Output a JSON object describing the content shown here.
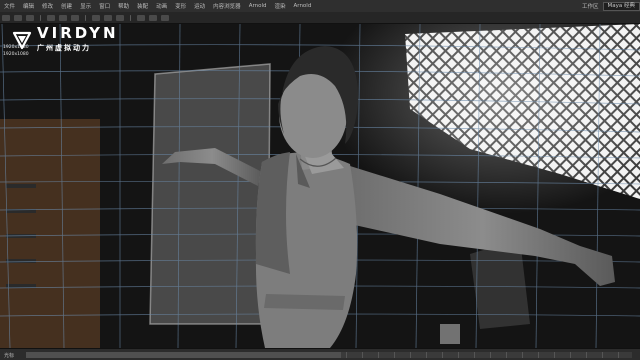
{
  "menubar": {
    "items": [
      "文件",
      "编辑",
      "修改",
      "创建",
      "显示",
      "窗口",
      "帮助",
      "装配",
      "动画",
      "变形",
      "运动",
      "内容浏览器",
      "Arnold",
      "渲染",
      "Arnold"
    ],
    "workspace_label": "工作区",
    "workspace_value": "Maya 经典"
  },
  "viewport": {
    "hud_line1": "1920x1080",
    "hud_line2": "1920x1080"
  },
  "logo": {
    "brand": "VIRDYN",
    "subtitle": "广州虚拟动力"
  },
  "statusbar": {
    "label": "光标",
    "frame": "",
    "timeline_progress": 0.52
  },
  "colors": {
    "accent_frame": "#8a3a3a"
  }
}
